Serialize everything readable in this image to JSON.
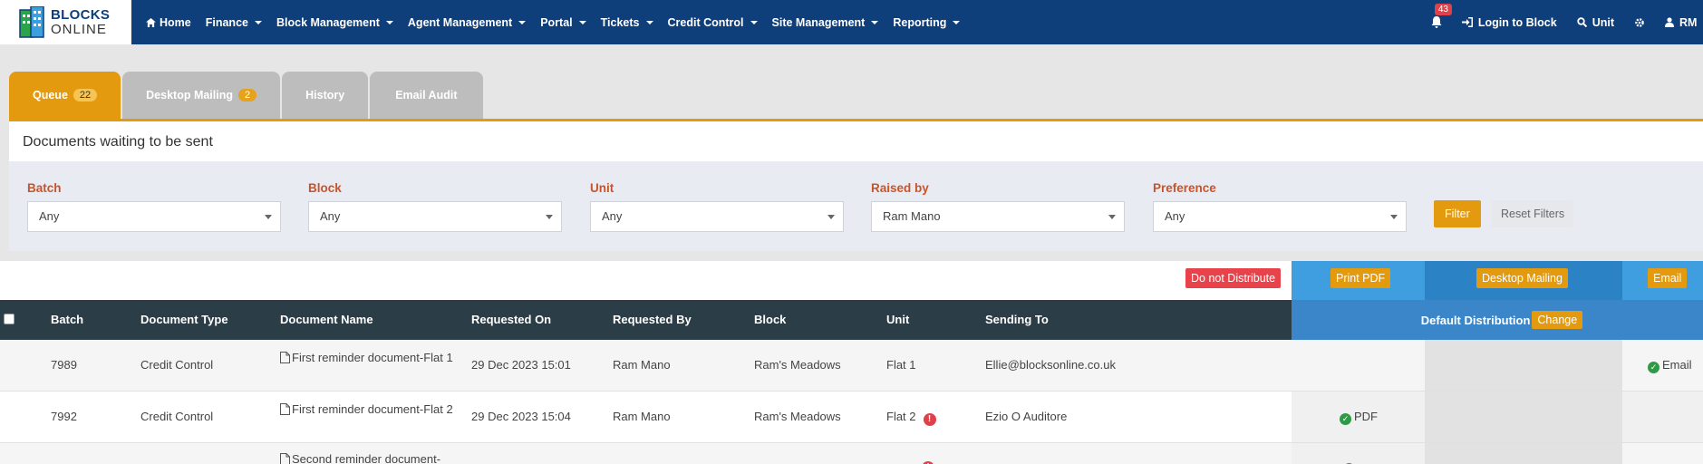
{
  "app": {
    "logo_line1": "BLOCKS",
    "logo_line2": "ONLINE"
  },
  "nav": {
    "items": [
      {
        "label": "Home",
        "has_caret": false
      },
      {
        "label": "Finance",
        "has_caret": true
      },
      {
        "label": "Block Management",
        "has_caret": true
      },
      {
        "label": "Agent Management",
        "has_caret": true
      },
      {
        "label": "Portal",
        "has_caret": true
      },
      {
        "label": "Tickets",
        "has_caret": true
      },
      {
        "label": "Credit Control",
        "has_caret": true
      },
      {
        "label": "Site Management",
        "has_caret": true
      },
      {
        "label": "Reporting",
        "has_caret": true
      }
    ],
    "notifications_count": "43",
    "login_to_block": "Login to Block",
    "unit_search": "Unit",
    "user_initials": "RM"
  },
  "tabs": [
    {
      "label": "Queue",
      "badge": "22",
      "active": true
    },
    {
      "label": "Desktop Mailing",
      "badge": "2",
      "active": false
    },
    {
      "label": "History",
      "badge": "",
      "active": false
    },
    {
      "label": "Email Audit",
      "badge": "",
      "active": false
    }
  ],
  "panel": {
    "title": "Documents waiting to be sent"
  },
  "filters": {
    "batch": {
      "label": "Batch",
      "value": "Any"
    },
    "block": {
      "label": "Block",
      "value": "Any"
    },
    "unit": {
      "label": "Unit",
      "value": "Any"
    },
    "raised_by": {
      "label": "Raised by",
      "value": "Ram Mano"
    },
    "preference": {
      "label": "Preference",
      "value": "Any"
    },
    "filter_button": "Filter",
    "reset_button": "Reset Filters"
  },
  "actions": {
    "do_not_distribute": "Do not Distribute",
    "print_pdf": "Print PDF",
    "desktop_mailing": "Desktop Mailing",
    "email": "Email"
  },
  "table": {
    "headers": {
      "batch": "Batch",
      "document_type": "Document Type",
      "document_name": "Document Name",
      "requested_on": "Requested On",
      "requested_by": "Requested By",
      "block": "Block",
      "unit": "Unit",
      "sending_to": "Sending To",
      "default_distribution": "Default Distribution",
      "change": "Change"
    },
    "rows": [
      {
        "batch": "7989",
        "document_type": "Credit Control",
        "document_name": "First reminder document-Flat 1",
        "requested_on": "29 Dec 2023 15:01",
        "requested_by": "Ram Mano",
        "block": "Ram's Meadows",
        "unit": "Flat 1",
        "sending_to": "Ellie@blocksonline.co.uk",
        "distribution_label": "Email"
      },
      {
        "batch": "7992",
        "document_type": "Credit Control",
        "document_name": "First reminder document-Flat 2",
        "requested_on": "29 Dec 2023 15:04",
        "requested_by": "Ram Mano",
        "block": "Ram's Meadows",
        "unit": "Flat 2",
        "sending_to": "Ezio O Auditore",
        "distribution_label": "PDF"
      },
      {
        "document_name": "Second reminder document-"
      }
    ]
  },
  "colors": {
    "nav_bg": "#0f3f7b",
    "accent_orange": "#e39a0f",
    "danger_red": "#e8434b",
    "table_header": "#2b3d46",
    "pdf_band": "#3e9ee0",
    "desk_band": "#2b82c4",
    "success_green": "#2e9a46"
  }
}
